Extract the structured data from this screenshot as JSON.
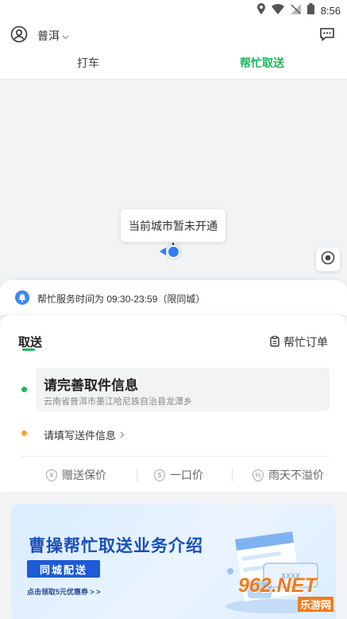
{
  "status_bar": {
    "time": "8:56"
  },
  "header": {
    "city": "普洱"
  },
  "tabs": [
    {
      "label": "打车"
    },
    {
      "label": "帮忙取送"
    }
  ],
  "map": {
    "tooltip": "当前城市暂未开通"
  },
  "notice": {
    "text": "帮忙服务时间为 09:30-23:59（限同城）"
  },
  "card": {
    "title": "取送",
    "orders_label": "帮忙订单",
    "pickup": {
      "title": "请完善取件信息",
      "address": "云南省普洱市墨江哈尼族自治县龙潭乡"
    },
    "delivery": {
      "label": "请填写送件信息"
    },
    "features": [
      {
        "label": "赠送保价",
        "icon": "shield-coin-icon"
      },
      {
        "label": "一口价",
        "icon": "price-tag-icon"
      },
      {
        "label": "雨天不溢价",
        "icon": "percent-icon"
      }
    ]
  },
  "banner": {
    "title": "曹操帮忙取送业务介绍",
    "chip": "同城配送",
    "coupon": "点击领取5元优惠券 > >",
    "card_text": "XXXX"
  },
  "watermark": {
    "number": "962.NET",
    "subtitle": "乐游网"
  },
  "colors": {
    "accent": "#1cb95a",
    "blue": "#2f7df6",
    "banner_text": "#174fb8"
  }
}
